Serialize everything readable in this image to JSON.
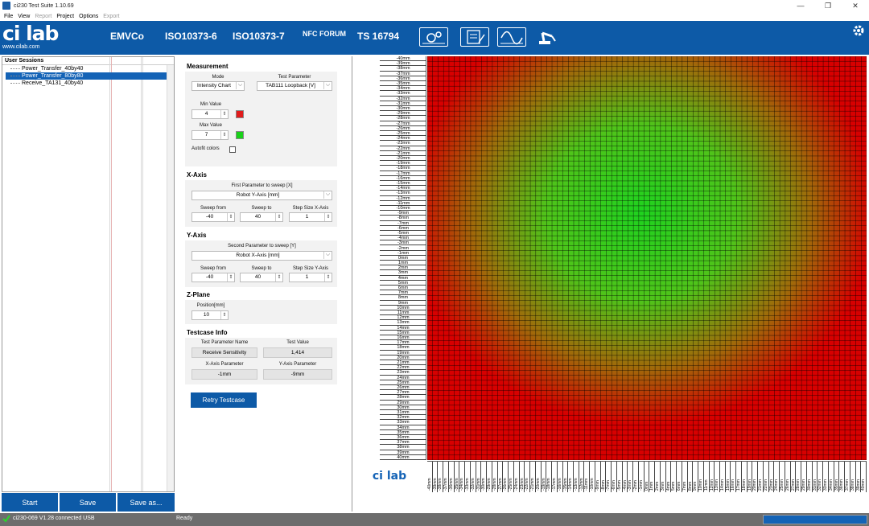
{
  "window": {
    "title": "ci230 Test Suite 1.10.69",
    "minimize": "—",
    "maximize": "❐",
    "close": "✕"
  },
  "menu": [
    {
      "label": "File",
      "enabled": true
    },
    {
      "label": "View",
      "enabled": true
    },
    {
      "label": "Report",
      "enabled": false
    },
    {
      "label": "Project",
      "enabled": true
    },
    {
      "label": "Options",
      "enabled": true
    },
    {
      "label": "Export",
      "enabled": false
    }
  ],
  "banner": {
    "brand": "ci lab",
    "url": "www.cilab.com",
    "standards": [
      "EMVCo",
      "ISO10373-6",
      "ISO10373-7",
      "NFC FORUM",
      "TS 16794"
    ],
    "tools": [
      "settings-cogs-icon",
      "checklist-icon",
      "oscilloscope-icon",
      "robot-arm-icon"
    ],
    "bg_color": "#0d5aa7"
  },
  "sessions": {
    "header": "User Sessions",
    "items": [
      {
        "label": "Power_Transfer_40by40",
        "selected": false
      },
      {
        "label": "Power_Transfer_80by80",
        "selected": true
      },
      {
        "label": "Receive_TA131_40by40",
        "selected": false
      }
    ]
  },
  "actions": {
    "start": "Start",
    "save": "Save",
    "save_as": "Save as..."
  },
  "measurement": {
    "title": "Measurement",
    "mode_label": "Mode",
    "mode_value": "Intensity Chart",
    "param_label": "Test Parameter",
    "param_value": "TAB111 Loopback [V]",
    "min_label": "Min Value",
    "min_value": "4",
    "min_color": "#e11b1b",
    "max_label": "Max Value",
    "max_value": "7",
    "max_color": "#19d119",
    "autofit_label": "Autofit colors",
    "autofit_checked": false
  },
  "xaxis": {
    "title": "X-Axis",
    "param_label": "First Parameter to sweep [X]",
    "param_value": "Robot Y-Axis [mm]",
    "from_label": "Sweep from",
    "from_value": "-40",
    "to_label": "Sweep to",
    "to_value": "40",
    "step_label": "Step Size X-Axis",
    "step_value": "1"
  },
  "yaxis": {
    "title": "Y-Axis",
    "param_label": "Second Parameter to sweep [Y]",
    "param_value": "Robot X-Axis [mm]",
    "from_label": "Sweep from",
    "from_value": "-40",
    "to_label": "Sweep to",
    "to_value": "40",
    "step_label": "Step Size Y-Axis",
    "step_value": "1"
  },
  "zplane": {
    "title": "Z-Plane",
    "position_label": "Position[mm]",
    "position_value": "10"
  },
  "testcase": {
    "title": "Testcase Info",
    "name_label": "Test Parameter Name",
    "name_value": "Receive Sensitivity",
    "value_label": "Test Value",
    "value_value": "1,414",
    "x_label": "X-Axis Parameter",
    "x_value": "-1mm",
    "y_label": "Y-Axis Parameter",
    "y_value": "-9mm",
    "retry": "Retry Testcase"
  },
  "heatmap": {
    "logo": "ci lab",
    "low_color": "#d70000",
    "high_color": "#1fd21f"
  },
  "chart_data": {
    "type": "heatmap",
    "x": {
      "from": -40,
      "to": 40,
      "step": 1,
      "unit": "mm"
    },
    "y": {
      "from": -40,
      "to": 40,
      "step": 1,
      "unit": "mm"
    },
    "color_range": [
      4,
      7
    ],
    "peak": {
      "x": -1,
      "y": -9
    }
  },
  "status": {
    "connection": "ci230-069 V1.28 connected USB",
    "state": "Ready",
    "progress": 1.0,
    "progress_color": "#1463b6"
  }
}
